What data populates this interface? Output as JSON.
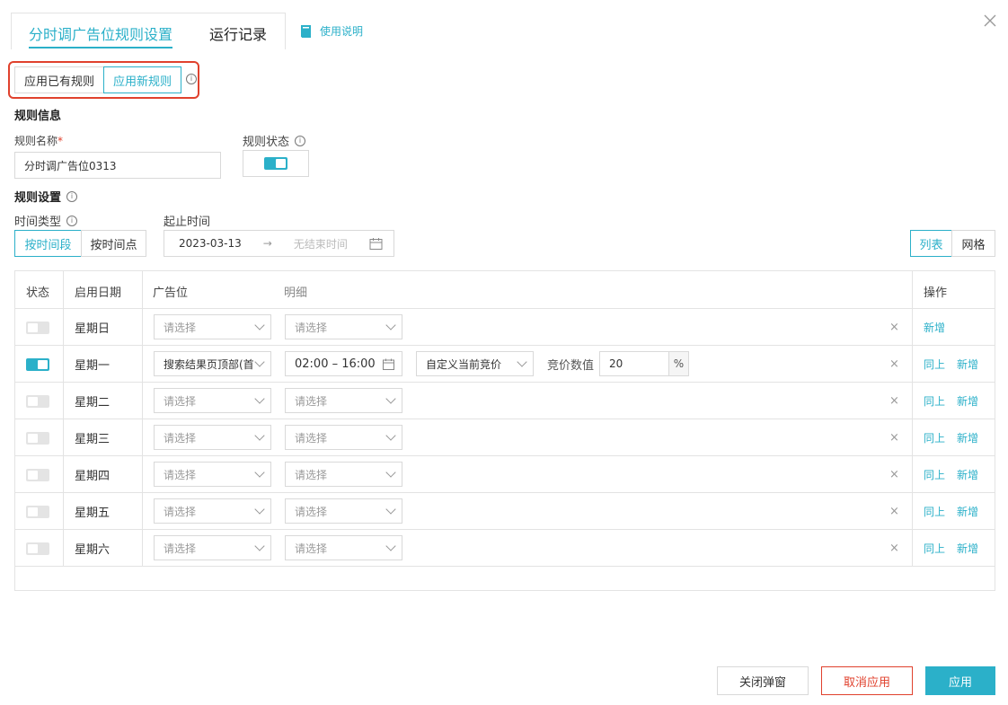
{
  "tabs": {
    "active": "分时调广告位规则设置",
    "second": "运行记录",
    "help": "使用说明"
  },
  "rule_mode": {
    "option_existing": "应用已有规则",
    "option_new": "应用新规则",
    "info": "i"
  },
  "rule_info": {
    "section_title": "规则信息",
    "name_label": "规则名称",
    "name_required": "*",
    "name_value": "分时调广告位0313",
    "status_label": "规则状态",
    "status_on": true
  },
  "rule_settings": {
    "section_title": "规则设置",
    "time_type_label": "时间类型",
    "time_type_options": [
      "按时间段",
      "按时间点"
    ],
    "time_type_selected": "按时间段",
    "date_range_label": "起止时间",
    "start_date": "2023-03-13",
    "arrow": "→",
    "end_placeholder": "无结束时间",
    "view_options": [
      "列表",
      "网格"
    ],
    "view_selected": "列表"
  },
  "table": {
    "headers": {
      "status": "状态",
      "start_date": "启用日期",
      "ad_slot": "广告位",
      "detail": "明细",
      "action": "操作"
    },
    "remove_icon": "×",
    "action_same_as_above": "同上",
    "action_add": "新增",
    "placeholder": "请选择",
    "rows": [
      {
        "day": "星期日",
        "on": false,
        "slot": "",
        "time": "",
        "bid_mode": "",
        "bid_label": "",
        "bid_value": "",
        "bid_unit": ""
      },
      {
        "day": "星期一",
        "on": true,
        "slot": "搜索结果页顶部(首",
        "time": "02:00 – 16:00",
        "bid_mode": "自定义当前竞价",
        "bid_label": "竞价数值",
        "bid_value": "20",
        "bid_unit": "%"
      },
      {
        "day": "星期二",
        "on": false,
        "slot": "",
        "time": "",
        "bid_mode": "",
        "bid_label": "",
        "bid_value": "",
        "bid_unit": ""
      },
      {
        "day": "星期三",
        "on": false,
        "slot": "",
        "time": "",
        "bid_mode": "",
        "bid_label": "",
        "bid_value": "",
        "bid_unit": ""
      },
      {
        "day": "星期四",
        "on": false,
        "slot": "",
        "time": "",
        "bid_mode": "",
        "bid_label": "",
        "bid_value": "",
        "bid_unit": ""
      },
      {
        "day": "星期五",
        "on": false,
        "slot": "",
        "time": "",
        "bid_mode": "",
        "bid_label": "",
        "bid_value": "",
        "bid_unit": ""
      },
      {
        "day": "星期六",
        "on": false,
        "slot": "",
        "time": "",
        "bid_mode": "",
        "bid_label": "",
        "bid_value": "",
        "bid_unit": ""
      }
    ]
  },
  "footer": {
    "close_label": "关闭弹窗",
    "cancel_label": "取消应用",
    "apply_label": "应用"
  },
  "colors": {
    "accent": "#2bb0c9",
    "danger": "#e0412d"
  }
}
